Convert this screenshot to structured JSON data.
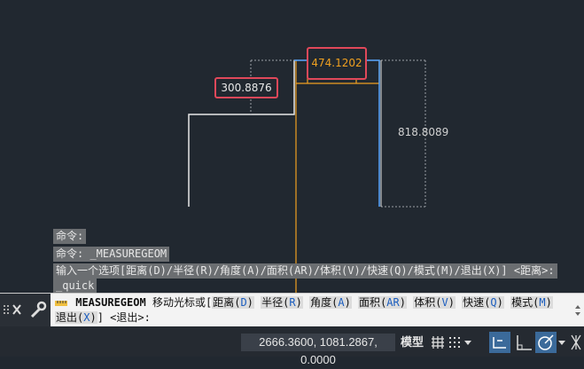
{
  "drawing": {
    "dim_left": "300.8876",
    "dim_top": "474.1202",
    "dim_right": "818.8089"
  },
  "history": [
    "命令:",
    "命令: _MEASUREGEOM",
    "输入一个选项[距离(D)/半径(R)/角度(A)/面积(AR)/体积(V)/快速(Q)/模式(M)/退出(X)] <距离>:",
    "_quick"
  ],
  "command": {
    "name": "MEASUREGEOM",
    "prompt": "移动光标或[",
    "options": [
      {
        "label": "距离",
        "key": "D"
      },
      {
        "label": "半径",
        "key": "R"
      },
      {
        "label": "角度",
        "key": "A"
      },
      {
        "label": "面积",
        "key": "AR"
      },
      {
        "label": "体积",
        "key": "V"
      },
      {
        "label": "快速",
        "key": "Q"
      },
      {
        "label": "模式",
        "key": "M"
      },
      {
        "label": "退出",
        "key": "X"
      }
    ],
    "default": "] <退出>:"
  },
  "status": {
    "coordinates": "2666.3600, 1081.2867, 0.0000",
    "model_label": "模型"
  },
  "colors": {
    "canvas_bg": "#212830",
    "highlight_red": "#e0485a",
    "dim_orange": "#f0a020",
    "select_blue": "#5aa8ff"
  },
  "icons": [
    "close-icon",
    "wrench-icon",
    "grid-icon",
    "snap-icon",
    "ortho-icon",
    "polar-icon",
    "chevron-down-icon",
    "ruler-icon"
  ]
}
